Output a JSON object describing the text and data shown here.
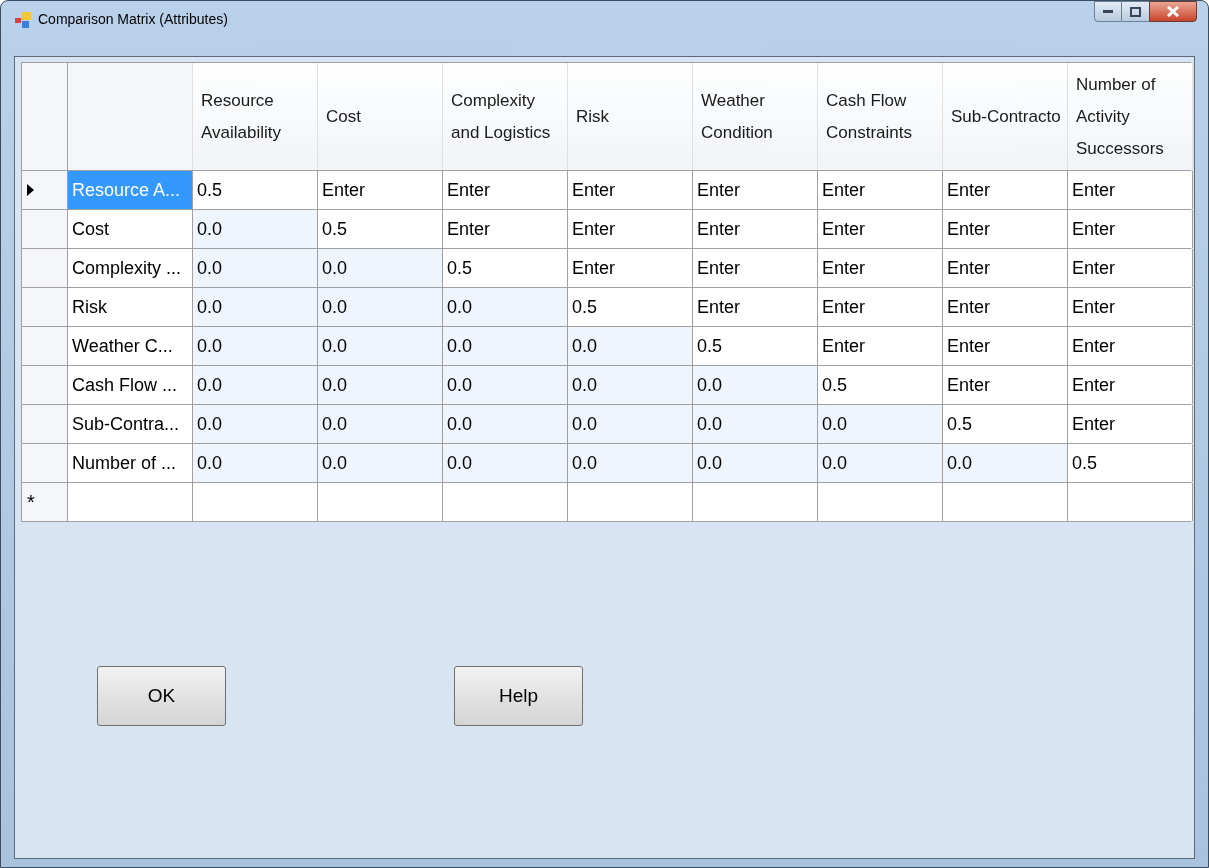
{
  "window": {
    "title": "Comparison Matrix (Attributes)"
  },
  "grid": {
    "columns": [
      "Resource Availability",
      "Cost",
      "Complexity and Logistics",
      "Risk",
      "Weather Condition",
      "Cash Flow Constraints",
      "Sub-Contracto",
      "Number of Activity Successors"
    ],
    "rows": [
      {
        "label": "Resource A...",
        "current": true,
        "selected": true,
        "cells": [
          {
            "value": "0.5",
            "locked": false
          },
          {
            "value": "Enter",
            "locked": false
          },
          {
            "value": "Enter",
            "locked": false
          },
          {
            "value": "Enter",
            "locked": false
          },
          {
            "value": "Enter",
            "locked": false
          },
          {
            "value": "Enter",
            "locked": false
          },
          {
            "value": "Enter",
            "locked": false
          },
          {
            "value": "Enter",
            "locked": false
          }
        ]
      },
      {
        "label": "Cost",
        "current": false,
        "selected": false,
        "cells": [
          {
            "value": "0.0",
            "locked": true
          },
          {
            "value": "0.5",
            "locked": false
          },
          {
            "value": "Enter",
            "locked": false
          },
          {
            "value": "Enter",
            "locked": false
          },
          {
            "value": "Enter",
            "locked": false
          },
          {
            "value": "Enter",
            "locked": false
          },
          {
            "value": "Enter",
            "locked": false
          },
          {
            "value": "Enter",
            "locked": false
          }
        ]
      },
      {
        "label": "Complexity ...",
        "current": false,
        "selected": false,
        "cells": [
          {
            "value": "0.0",
            "locked": true
          },
          {
            "value": "0.0",
            "locked": true
          },
          {
            "value": "0.5",
            "locked": false
          },
          {
            "value": "Enter",
            "locked": false
          },
          {
            "value": "Enter",
            "locked": false
          },
          {
            "value": "Enter",
            "locked": false
          },
          {
            "value": "Enter",
            "locked": false
          },
          {
            "value": "Enter",
            "locked": false
          }
        ]
      },
      {
        "label": "Risk",
        "current": false,
        "selected": false,
        "cells": [
          {
            "value": "0.0",
            "locked": true
          },
          {
            "value": "0.0",
            "locked": true
          },
          {
            "value": "0.0",
            "locked": true
          },
          {
            "value": "0.5",
            "locked": false
          },
          {
            "value": "Enter",
            "locked": false
          },
          {
            "value": "Enter",
            "locked": false
          },
          {
            "value": "Enter",
            "locked": false
          },
          {
            "value": "Enter",
            "locked": false
          }
        ]
      },
      {
        "label": "Weather C...",
        "current": false,
        "selected": false,
        "cells": [
          {
            "value": "0.0",
            "locked": true
          },
          {
            "value": "0.0",
            "locked": true
          },
          {
            "value": "0.0",
            "locked": true
          },
          {
            "value": "0.0",
            "locked": true
          },
          {
            "value": "0.5",
            "locked": false
          },
          {
            "value": "Enter",
            "locked": false
          },
          {
            "value": "Enter",
            "locked": false
          },
          {
            "value": "Enter",
            "locked": false
          }
        ]
      },
      {
        "label": "Cash Flow ...",
        "current": false,
        "selected": false,
        "cells": [
          {
            "value": "0.0",
            "locked": true
          },
          {
            "value": "0.0",
            "locked": true
          },
          {
            "value": "0.0",
            "locked": true
          },
          {
            "value": "0.0",
            "locked": true
          },
          {
            "value": "0.0",
            "locked": true
          },
          {
            "value": "0.5",
            "locked": false
          },
          {
            "value": "Enter",
            "locked": false
          },
          {
            "value": "Enter",
            "locked": false
          }
        ]
      },
      {
        "label": "Sub-Contra...",
        "current": false,
        "selected": false,
        "cells": [
          {
            "value": "0.0",
            "locked": true
          },
          {
            "value": "0.0",
            "locked": true
          },
          {
            "value": "0.0",
            "locked": true
          },
          {
            "value": "0.0",
            "locked": true
          },
          {
            "value": "0.0",
            "locked": true
          },
          {
            "value": "0.0",
            "locked": true
          },
          {
            "value": "0.5",
            "locked": false
          },
          {
            "value": "Enter",
            "locked": false
          }
        ]
      },
      {
        "label": "Number of ...",
        "current": false,
        "selected": false,
        "cells": [
          {
            "value": "0.0",
            "locked": true
          },
          {
            "value": "0.0",
            "locked": true
          },
          {
            "value": "0.0",
            "locked": true
          },
          {
            "value": "0.0",
            "locked": true
          },
          {
            "value": "0.0",
            "locked": true
          },
          {
            "value": "0.0",
            "locked": true
          },
          {
            "value": "0.0",
            "locked": true
          },
          {
            "value": "0.5",
            "locked": false
          }
        ]
      }
    ],
    "new_row_marker": "*"
  },
  "buttons": [
    "OK",
    "Help"
  ]
}
